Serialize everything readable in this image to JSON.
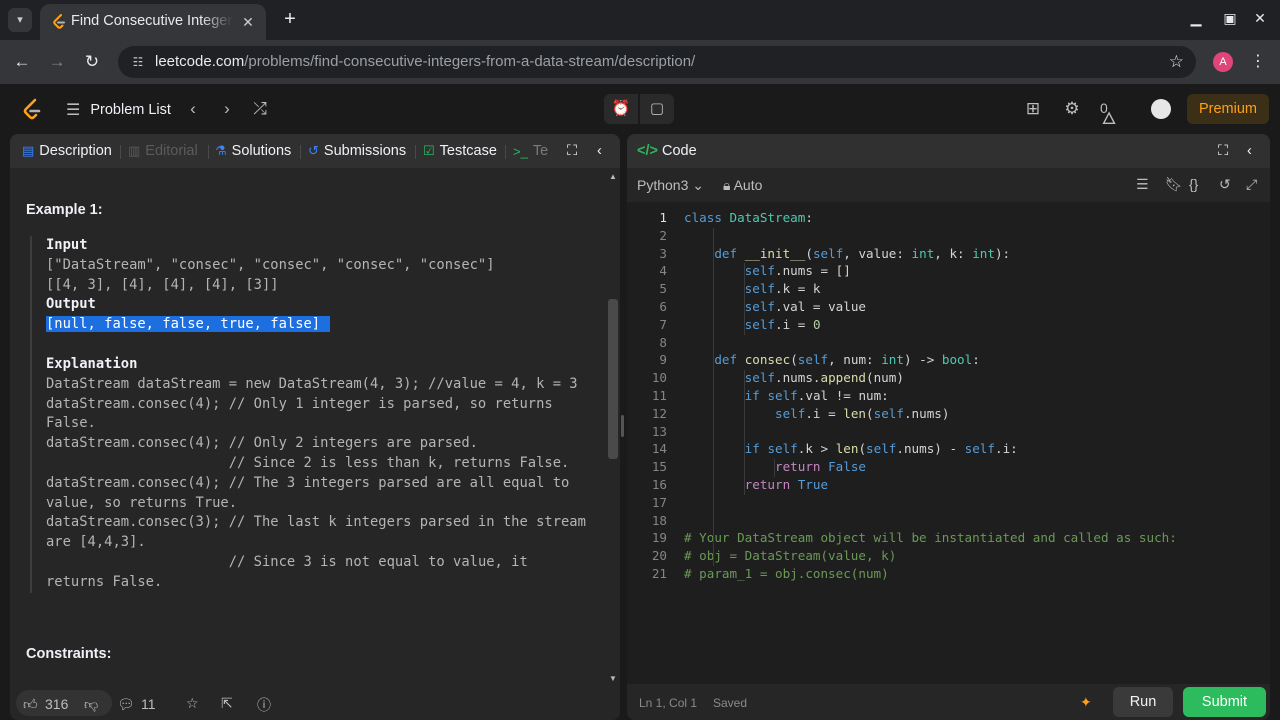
{
  "browser": {
    "tab_title": "Find Consecutive Integers from a Data Stream",
    "url_host": "leetcode.com",
    "url_path": "/problems/find-consecutive-integers-from-a-data-stream/description/",
    "profile_initial": "A"
  },
  "header": {
    "problem_list": "Problem List",
    "streak_count": "0",
    "premium_label": "Premium"
  },
  "left_tabs": {
    "description": "Description",
    "editorial": "Editorial",
    "solutions": "Solutions",
    "submissions": "Submissions",
    "testcase": "Testcase",
    "test_result": "Te"
  },
  "example": {
    "title": "Example 1:",
    "input_label": "Input",
    "input_line1": "[\"DataStream\", \"consec\", \"consec\", \"consec\", \"consec\"]",
    "input_line2": "[[4, 3], [4], [4], [4], [3]]",
    "output_label": "Output",
    "output_value": "[null, false, false, true, false]",
    "explanation_label": "Explanation",
    "explanation_text": "DataStream dataStream = new DataStream(4, 3); //value = 4, k = 3\ndataStream.consec(4); // Only 1 integer is parsed, so returns\nFalse.\ndataStream.consec(4); // Only 2 integers are parsed.\n                      // Since 2 is less than k, returns False.\ndataStream.consec(4); // The 3 integers parsed are all equal to\nvalue, so returns True.\ndataStream.consec(3); // The last k integers parsed in the stream\nare [4,4,3].\n                      // Since 3 is not equal to value, it\nreturns False."
  },
  "constraints_title": "Constraints:",
  "left_footer": {
    "likes": "316",
    "comments": "11"
  },
  "code_panel": {
    "tab_label": "Code",
    "language": "Python3",
    "mode": "Auto",
    "cursor_pos": "Ln 1, Col 1",
    "save_status": "Saved",
    "run_label": "Run",
    "submit_label": "Submit"
  },
  "code_lines": [
    "class DataStream:",
    "",
    "    def __init__(self, value: int, k: int):",
    "        self.nums = []",
    "        self.k = k",
    "        self.val = value",
    "        self.i = 0",
    "",
    "    def consec(self, num: int) -> bool:",
    "        self.nums.append(num)",
    "        if self.val != num:",
    "            self.i = len(self.nums)",
    "",
    "        if self.k > len(self.nums) - self.i:",
    "            return False",
    "        return True",
    "",
    "",
    "# Your DataStream object will be instantiated and called as such:",
    "# obj = DataStream(value, k)",
    "# param_1 = obj.consec(num)"
  ],
  "colors": {
    "accent_green": "#2cbb5d",
    "premium_orange": "#ffa116",
    "selection_blue": "#1d6fe0"
  }
}
